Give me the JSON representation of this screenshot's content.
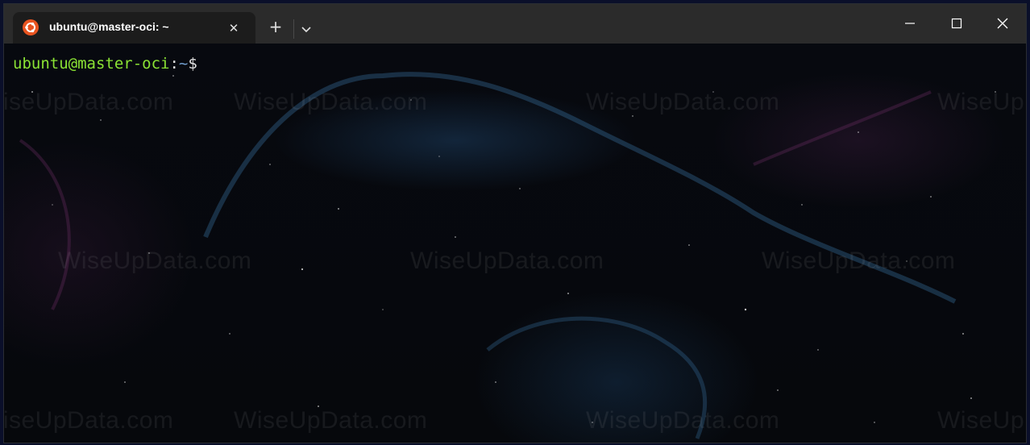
{
  "window": {
    "tab": {
      "title": "ubuntu@master-oci: ~",
      "icon": "ubuntu-icon",
      "close_glyph": "✕"
    },
    "new_tab_glyph": "+",
    "dropdown_icon": "chevron-down-icon",
    "controls": [
      "minimize-icon",
      "maximize-icon",
      "close-icon"
    ]
  },
  "terminal": {
    "prompt": {
      "user_host": "ubuntu@master-oci",
      "colon": ":",
      "path": "~",
      "symbol": "$"
    },
    "watermark_text": "WiseUpData.com",
    "colors": {
      "user_host": "#8ae234",
      "path": "#729fcf",
      "tab_bg": "#1c1c1c",
      "titlebar_bg": "#2b2b2b"
    }
  }
}
